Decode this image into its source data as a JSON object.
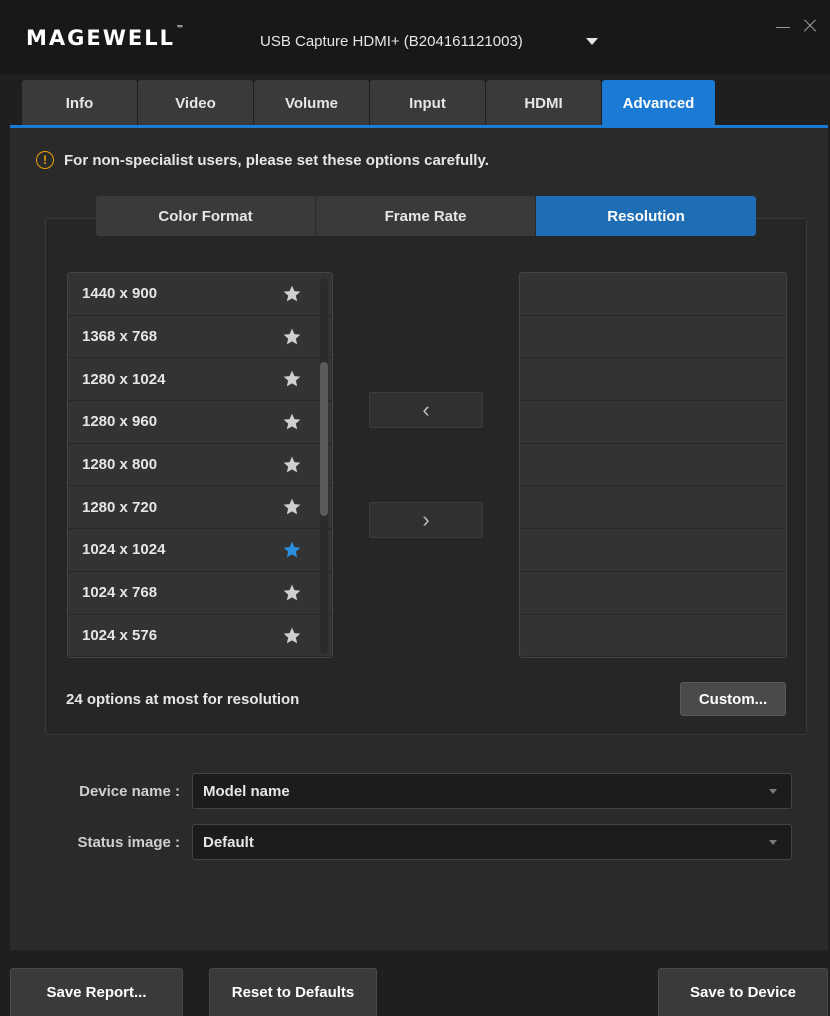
{
  "app": {
    "logo": "MAGEWELL",
    "logo_tm": "™",
    "device_title": "USB Capture HDMI+ (B204161121003)"
  },
  "tabs": [
    {
      "label": "Info",
      "active": false
    },
    {
      "label": "Video",
      "active": false
    },
    {
      "label": "Volume",
      "active": false
    },
    {
      "label": "Input",
      "active": false
    },
    {
      "label": "HDMI",
      "active": false
    },
    {
      "label": "Advanced",
      "active": true
    }
  ],
  "warning": {
    "icon": "exclamation-circle-icon",
    "text": "For non-specialist users, please set these options carefully."
  },
  "subtabs": [
    {
      "label": "Color Format",
      "active": false
    },
    {
      "label": "Frame Rate",
      "active": false
    },
    {
      "label": "Resolution",
      "active": true
    }
  ],
  "resolutions": [
    {
      "label": "1440 x 900",
      "starred": false
    },
    {
      "label": "1368 x 768",
      "starred": false
    },
    {
      "label": "1280 x 1024",
      "starred": false
    },
    {
      "label": "1280 x 960",
      "starred": false
    },
    {
      "label": "1280 x 800",
      "starred": false
    },
    {
      "label": "1280 x 720",
      "starred": false
    },
    {
      "label": "1024 x 1024",
      "starred": true
    },
    {
      "label": "1024 x 768",
      "starred": false
    },
    {
      "label": "1024 x 576",
      "starred": false
    }
  ],
  "buttons": {
    "move_left": "‹",
    "move_right": "›",
    "custom": "Custom...",
    "save_report": "Save Report...",
    "reset_defaults": "Reset to Defaults",
    "save_device": "Save to Device"
  },
  "limit_text": "24 options at most for resolution",
  "fields": {
    "device_name": {
      "label": "Device name :",
      "value": "Model name"
    },
    "status_image": {
      "label": "Status image :",
      "value": "Default"
    }
  },
  "colors": {
    "accent": "#1a7ad4",
    "star_active": "#2b8fe0",
    "star_inactive": "#cfcfcf",
    "warning": "#e6a300"
  }
}
